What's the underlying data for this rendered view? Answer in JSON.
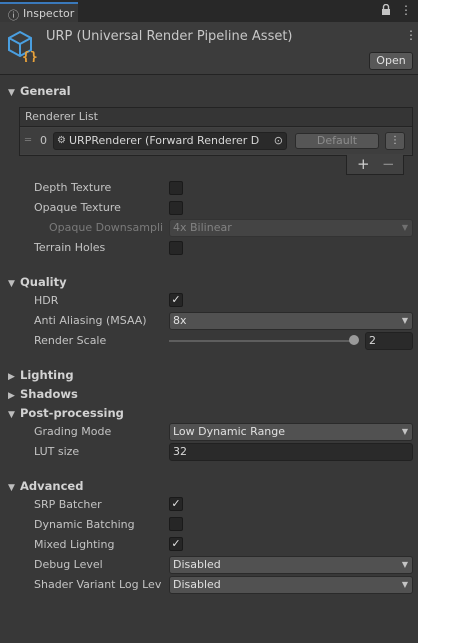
{
  "tab": {
    "icon": "info-icon",
    "label": "Inspector"
  },
  "toolbar": {
    "lock_icon": "lock-icon",
    "menu_icon": "kebab-menu-icon"
  },
  "header": {
    "asset_icon": "render-pipeline-asset-icon",
    "title": "URP (Universal Render Pipeline Asset)",
    "open_label": "Open"
  },
  "general": {
    "title": "General",
    "renderer_list": {
      "title": "Renderer List",
      "rows": [
        {
          "index": "0",
          "renderer": "URPRenderer (Forward Renderer D",
          "default_label": "Default"
        }
      ],
      "add": "+",
      "remove": "−"
    },
    "depth_texture": {
      "label": "Depth Texture",
      "checked": false
    },
    "opaque_texture": {
      "label": "Opaque Texture",
      "checked": false
    },
    "opaque_downsampling": {
      "label": "Opaque Downsampli",
      "value": "4x Bilinear"
    },
    "terrain_holes": {
      "label": "Terrain Holes",
      "checked": false
    }
  },
  "quality": {
    "title": "Quality",
    "hdr": {
      "label": "HDR",
      "checked": true
    },
    "anti_aliasing": {
      "label": "Anti Aliasing (MSAA)",
      "value": "8x"
    },
    "render_scale": {
      "label": "Render Scale",
      "value": "2",
      "slider_fraction": 1.0
    }
  },
  "lighting": {
    "title": "Lighting"
  },
  "shadows": {
    "title": "Shadows"
  },
  "post_processing": {
    "title": "Post-processing",
    "grading_mode": {
      "label": "Grading Mode",
      "value": "Low Dynamic Range"
    },
    "lut_size": {
      "label": "LUT size",
      "value": "32"
    }
  },
  "advanced": {
    "title": "Advanced",
    "srp_batcher": {
      "label": "SRP Batcher",
      "checked": true
    },
    "dynamic_batching": {
      "label": "Dynamic Batching",
      "checked": false
    },
    "mixed_lighting": {
      "label": "Mixed Lighting",
      "checked": true
    },
    "debug_level": {
      "label": "Debug Level",
      "value": "Disabled"
    },
    "shader_variant_log": {
      "label": "Shader Variant Log Lev",
      "value": "Disabled"
    }
  },
  "colors": {
    "panel": "#383838",
    "tab_accent": "#3a79bb",
    "asset_icon": "#4a9fe0",
    "asset_icon_accent": "#e8a23b"
  }
}
